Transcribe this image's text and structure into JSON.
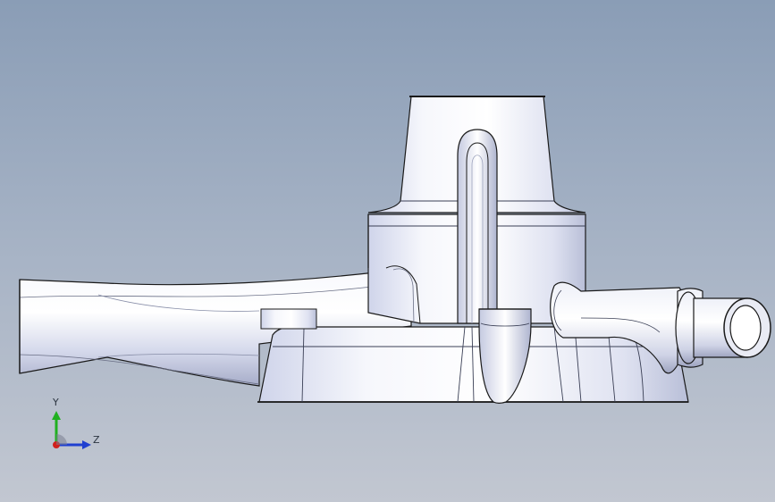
{
  "viewport": {
    "background_top": "#8a9db6",
    "background_bottom": "#c2c7d1",
    "model_name": "pump-housing-3d-model"
  },
  "triad": {
    "y_label": "Y",
    "z_label": "Z",
    "x_color": "#d0201c",
    "y_color": "#20b020",
    "z_color": "#1f3fd0"
  }
}
